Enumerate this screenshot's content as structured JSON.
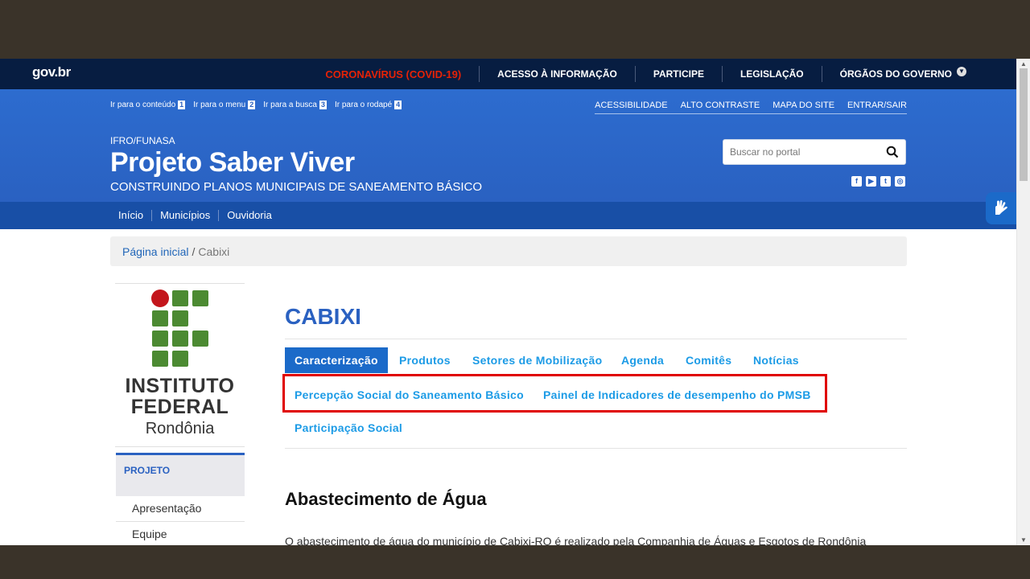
{
  "gov": {
    "logo": "gov.br",
    "links": [
      "CORONAVÍRUS (COVID-19)",
      "ACESSO À INFORMAÇÃO",
      "PARTICIPE",
      "LEGISLAÇÃO",
      "ÓRGÃOS DO GOVERNO"
    ]
  },
  "skip_links": [
    {
      "label": "Ir para o conteúdo",
      "num": "1"
    },
    {
      "label": "Ir para o menu",
      "num": "2"
    },
    {
      "label": "Ir para a busca",
      "num": "3"
    },
    {
      "label": "Ir para o rodapé",
      "num": "4"
    }
  ],
  "util_links": [
    "ACESSIBILIDADE",
    "ALTO CONTRASTE",
    "MAPA DO SITE",
    "ENTRAR/SAIR"
  ],
  "site": {
    "subtitle": "IFRO/FUNASA",
    "title": "Projeto Saber Viver",
    "description": "CONSTRUINDO PLANOS MUNICIPAIS DE SANEAMENTO BÁSICO"
  },
  "search": {
    "placeholder": "Buscar no portal"
  },
  "nav": [
    "Início",
    "Municípios",
    "Ouvidoria"
  ],
  "breadcrumb": {
    "home": "Página inicial",
    "sep": "/",
    "current": "Cabixi"
  },
  "sidebar": {
    "logo_lines": [
      "INSTITUTO",
      "FEDERAL",
      "Rondônia"
    ],
    "menu_head": "PROJETO",
    "items": [
      "Apresentação",
      "Equipe"
    ]
  },
  "main": {
    "title": "CABIXI",
    "tabs": {
      "caracterizacao": "Caracterização",
      "produtos": "Produtos",
      "setores": "Setores de Mobilização",
      "agenda": "Agenda",
      "comites": "Comitês",
      "noticias": "Notícias",
      "percepcao": "Percepção Social do Saneamento Básico",
      "painel": "Painel de Indicadores de desempenho do PMSB",
      "participacao": "Participação Social"
    },
    "section_heading": "Abastecimento de Água",
    "paragraph": "O abastecimento de água do município de Cabixi-RO é realizado pela Companhia de Águas e Esgotos de Rondônia"
  },
  "colors": {
    "gov_bar": "#071d41",
    "header_blue": "#2a61c1",
    "nav_blue": "#184fa6",
    "highlight": "#e00000",
    "link": "#1c9be6",
    "covid": "#e52207"
  }
}
